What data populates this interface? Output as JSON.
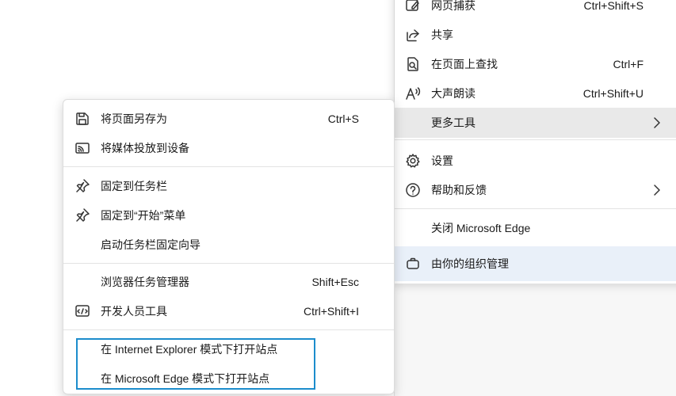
{
  "main_menu": {
    "items": [
      {
        "label": "网页捕获",
        "shortcut": "Ctrl+Shift+S",
        "icon": "capture-icon"
      },
      {
        "label": "共享",
        "shortcut": "",
        "icon": "share-icon"
      },
      {
        "label": "在页面上查找",
        "shortcut": "Ctrl+F",
        "icon": "find-icon"
      },
      {
        "label": "大声朗读",
        "shortcut": "Ctrl+Shift+U",
        "icon": "read-aloud-icon"
      },
      {
        "label": "更多工具",
        "shortcut": "",
        "icon": ""
      },
      {
        "label": "设置",
        "shortcut": "",
        "icon": "gear-icon"
      },
      {
        "label": "帮助和反馈",
        "shortcut": "",
        "icon": "help-icon"
      },
      {
        "label": "关闭 Microsoft Edge",
        "shortcut": "",
        "icon": ""
      },
      {
        "label": "由你的组织管理",
        "shortcut": "",
        "icon": "briefcase-icon"
      }
    ]
  },
  "sub_menu": {
    "items": [
      {
        "label": "将页面另存为",
        "shortcut": "Ctrl+S",
        "icon": "save-icon"
      },
      {
        "label": "将媒体投放到设备",
        "shortcut": "",
        "icon": "cast-icon"
      },
      {
        "label": "固定到任务栏",
        "shortcut": "",
        "icon": "pin-icon"
      },
      {
        "label": "固定到“开始”菜单",
        "shortcut": "",
        "icon": "pin-icon"
      },
      {
        "label": "启动任务栏固定向导",
        "shortcut": "",
        "icon": ""
      },
      {
        "label": "浏览器任务管理器",
        "shortcut": "Shift+Esc",
        "icon": ""
      },
      {
        "label": "开发人员工具",
        "shortcut": "Ctrl+Shift+I",
        "icon": "devtools-icon"
      },
      {
        "label": "在 Internet Explorer 模式下打开站点",
        "shortcut": "",
        "icon": ""
      },
      {
        "label": "在 Microsoft Edge 模式下打开站点",
        "shortcut": "",
        "icon": ""
      }
    ]
  },
  "colors": {
    "highlight_box": "#1c8ccc",
    "hover": "#e9e9e9",
    "managed": "#e9f0f9"
  }
}
